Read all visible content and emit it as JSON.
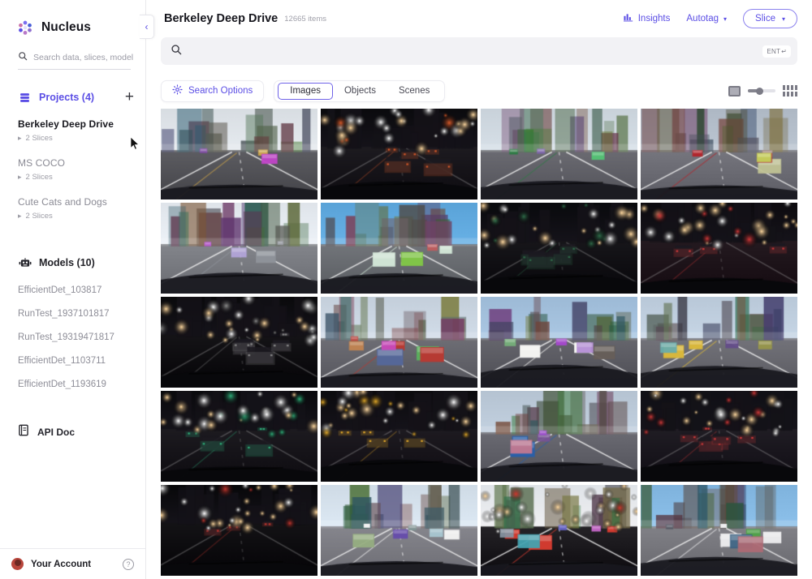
{
  "brand": {
    "name": "Nucleus",
    "logo_icon": "nucleus-logo-icon"
  },
  "sidebar": {
    "search": {
      "placeholder": "Search data, slices, model",
      "value": "",
      "icon": "search-icon"
    },
    "projects_section": {
      "label": "Projects (4)",
      "icon": "database-icon",
      "add_label": "+"
    },
    "projects": [
      {
        "title": "Berkeley Deep Drive",
        "slices": "2 Slices",
        "active": true
      },
      {
        "title": "MS COCO",
        "slices": "2 Slices",
        "active": false
      },
      {
        "title": "Cute Cats and Dogs",
        "slices": "2 Slices",
        "active": false
      }
    ],
    "models_section": {
      "label": "Models (10)",
      "icon": "robot-icon"
    },
    "models": [
      {
        "name": "EfficientDet_103817"
      },
      {
        "name": "RunTest_1937101817"
      },
      {
        "name": "RunTest_19319471817"
      },
      {
        "name": "EfficientDet_1103711"
      },
      {
        "name": "EfficientDet_1193619"
      }
    ],
    "api_doc": {
      "label": "API Doc",
      "icon": "book-icon"
    },
    "account": {
      "label": "Your Account",
      "avatar": "user-avatar",
      "help_icon": "help-icon"
    },
    "collapse_icon": "chevron-left-icon"
  },
  "header": {
    "title": "Berkeley Deep Drive",
    "item_count": "12665 items",
    "insights_label": "Insights",
    "insights_icon": "bar-chart-icon",
    "autotag_label": "Autotag",
    "autotag_caret": "▾",
    "slice_label": "Slice",
    "slice_caret": "▾"
  },
  "search": {
    "placeholder": "",
    "value": "",
    "icon": "search-icon",
    "enter_badge": "ENT",
    "enter_glyph": "↵"
  },
  "filters": {
    "search_options_label": "Search Options",
    "search_options_icon": "gear-icon",
    "tabs": [
      {
        "label": "Images",
        "active": true
      },
      {
        "label": "Objects",
        "active": false
      },
      {
        "label": "Scenes",
        "active": false
      }
    ],
    "view": {
      "large_icon": "large-thumbnail-icon",
      "slider": "thumbnail-size-slider",
      "small_icon": "small-thumbnail-grid-icon",
      "size_value": "30"
    }
  },
  "colors": {
    "accent": "#5b4ee5",
    "accent_border": "#8b81ee",
    "text_dark": "#16161d",
    "text_muted": "#8d8d97",
    "panel_bg": "#f2f2f5"
  },
  "gallery": {
    "columns": 4,
    "rows": 5,
    "items": [
      {
        "id": "img-1",
        "scene": "day-tree-lined-street-parked-cars",
        "time": "day",
        "sky": "#d8dde2",
        "road": "#55555a",
        "accent": "#c9a24a"
      },
      {
        "id": "img-2",
        "scene": "night-dark-road-headlights",
        "time": "night",
        "sky": "#0b0b0e",
        "road": "#232126",
        "accent": "#d85a2a"
      },
      {
        "id": "img-3",
        "scene": "day-highway-overpass",
        "time": "day",
        "sky": "#c9d2da",
        "road": "#63636a",
        "accent": "#2f7a45"
      },
      {
        "id": "img-4",
        "scene": "day-bus-beside-dashboard",
        "time": "day",
        "sky": "#aeb8c4",
        "road": "#6e6e76",
        "accent": "#b0262d"
      },
      {
        "id": "img-5",
        "scene": "day-overcast-highway-guardrail",
        "time": "day",
        "sky": "#dfe4ea",
        "road": "#7b7d83",
        "accent": "#8e9299"
      },
      {
        "id": "img-6",
        "scene": "day-blue-sky-traffic-wet-windshield",
        "time": "day",
        "sky": "#5aa3d8",
        "road": "#6a6d72",
        "accent": "#cfe3d4"
      },
      {
        "id": "img-7",
        "scene": "night-empty-road-streetlight",
        "time": "night",
        "sky": "#090a0d",
        "road": "#1d1c20",
        "accent": "#2f6d4a"
      },
      {
        "id": "img-8",
        "scene": "night-overpass-red-lights",
        "time": "night",
        "sky": "#0d0b0f",
        "road": "#2a2026",
        "accent": "#d33a3a"
      },
      {
        "id": "img-9",
        "scene": "night-dark-truck-ahead",
        "time": "night",
        "sky": "#0a0a0c",
        "road": "#1b1a1d",
        "accent": "#8c8c8c"
      },
      {
        "id": "img-10",
        "scene": "day-city-street-red-truck",
        "time": "day",
        "sky": "#c4cfdb",
        "road": "#66666d",
        "accent": "#b63a33"
      },
      {
        "id": "img-11",
        "scene": "day-white-van-brick-buildings",
        "time": "day",
        "sky": "#9dbad6",
        "road": "#5e5e65",
        "accent": "#f2f2f0"
      },
      {
        "id": "img-12",
        "scene": "day-two-lane-road-parked-cars",
        "time": "day",
        "sky": "#b9c8d8",
        "road": "#6b6b72",
        "accent": "#d8b73c"
      },
      {
        "id": "img-13",
        "scene": "night-crosswalk-green-light",
        "time": "night",
        "sky": "#0a0a0d",
        "road": "#232126",
        "accent": "#2fb07a"
      },
      {
        "id": "img-14",
        "scene": "night-yellow-taxi-brake-lights",
        "time": "night",
        "sky": "#0c0b0e",
        "road": "#242127",
        "accent": "#e2a92a"
      },
      {
        "id": "img-15",
        "scene": "day-city-bus-taxis",
        "time": "day",
        "sky": "#b5c3d2",
        "road": "#62626a",
        "accent": "#2a5fa8"
      },
      {
        "id": "img-16",
        "scene": "night-rainy-street-tail-lights",
        "time": "night",
        "sky": "#101016",
        "road": "#26232a",
        "accent": "#d03a3a"
      },
      {
        "id": "img-17",
        "scene": "night-dark-road-distant-lights",
        "time": "night",
        "sky": "#08080a",
        "road": "#1a191c",
        "accent": "#c4372f"
      },
      {
        "id": "img-18",
        "scene": "day-tree-lined-street-white-van",
        "time": "day",
        "sky": "#cfdbe6",
        "road": "#7e7e85",
        "accent": "#efefef"
      },
      {
        "id": "img-19",
        "scene": "dusk-backlit-street-red-lights",
        "time": "dusk",
        "sky": "#dfe3e8",
        "road": "#1d1b1f",
        "accent": "#d03a2f"
      },
      {
        "id": "img-20",
        "scene": "day-intersection-taxi-hood-sign",
        "time": "day",
        "sky": "#7fb3dd",
        "road": "#79797f",
        "accent": "#e8e8ea"
      }
    ]
  }
}
